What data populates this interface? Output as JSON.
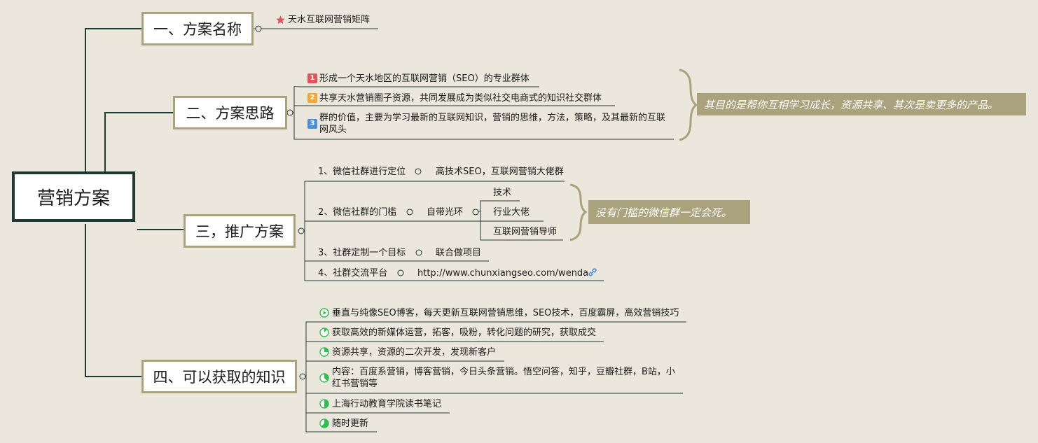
{
  "root": {
    "label": "营销方案"
  },
  "branches": {
    "name": {
      "label": "一、方案名称",
      "items": [
        "天水互联网营销矩阵"
      ]
    },
    "idea": {
      "label": "二、方案思路",
      "items": [
        {
          "num": "1",
          "text": "形成一个天水地区的互联网营销（SEO）的专业群体"
        },
        {
          "num": "2",
          "text": "共享天水营销圈子资源，共同发展成为类似社交电商式的知识社交群体"
        },
        {
          "num": "3",
          "line1": "群的价值，主要为学习最新的互联网知识，营销的思维，方法，策略，及其最新的互联",
          "line2": "网风头"
        }
      ],
      "summary": "其目的是帮你互相学习成长，资源共享、其次是卖更多的产品。"
    },
    "promo": {
      "label": "三，推广方案",
      "items": [
        {
          "text": "1、微信社群进行定位",
          "child": "高技术SEO，互联网营销大佬群"
        },
        {
          "text": "2、微信社群的门槛",
          "child": "自带光环",
          "grandchildren": [
            "技术",
            "行业大佬",
            "互联网营销导师"
          ]
        },
        {
          "text": "3、社群定制一个目标",
          "child": "联合做项目"
        },
        {
          "text": "4、社群交流平台",
          "child": "http://www.chunxiangseo.com/wenda"
        }
      ],
      "summary": "没有门槛的微信群一定会死。"
    },
    "knowledge": {
      "label": "四、可以获取的知识",
      "items": [
        {
          "text": "垂直与纯像SEO博客，每天更新互联网营销思维，SEO技术，百度霸屏，高效营销技巧",
          "progress": 0
        },
        {
          "text": "获取高效的新媒体运营，拓客，吸粉，转化问题的研究，获取成交",
          "progress": 0.125
        },
        {
          "text": "资源共享，资源的二次开发，发现新客户",
          "progress": 0.25
        },
        {
          "line1": "内容：百度系营销，博客营销，今日头条营销。悟空问答，知乎，豆瓣社群，B站，小",
          "line2": "红书营销等",
          "progress": 0.375
        },
        {
          "text": "上海行动教育学院读书笔记",
          "progress": 0.5
        },
        {
          "text": "随时更新",
          "progress": 0.625
        }
      ]
    }
  },
  "colors": {
    "background": "#ebe7dc",
    "root_border": "#1e3a33",
    "branch_border": "#a9a27c",
    "summary_bg": "#a9a27c",
    "line": "#1e3a33",
    "badge_1": "#e05555",
    "badge_2": "#f0a830",
    "badge_3": "#4a8ee0",
    "star": "#e05555",
    "progress_green": "#2fbf4f"
  },
  "icons": {
    "star": "star-icon",
    "link": "link-icon",
    "task_start": "play-icon",
    "task_progress": "progress-pie-icon"
  }
}
